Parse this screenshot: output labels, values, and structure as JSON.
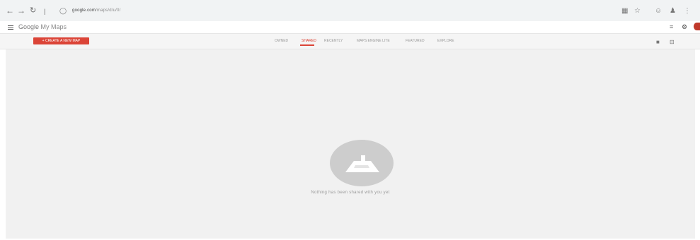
{
  "browser": {
    "url_host": "google.com",
    "url_path": "/maps/d/u/0/",
    "icons": [
      "back-icon",
      "forward-icon",
      "reload-icon",
      "site-info-icon",
      "extensions-icon",
      "star-icon",
      "profile-icon",
      "menu-icon"
    ]
  },
  "app": {
    "title_brand": "Google",
    "title_product": "My Maps"
  },
  "toolbar": {
    "create_button": "+ CREATE A NEW MAP",
    "tabs": [
      {
        "label": "OWNED"
      },
      {
        "label": "SHARED"
      },
      {
        "label": "RECENTLY"
      },
      {
        "label": "MAPS ENGINE LITE"
      },
      {
        "label": "FEATURED"
      },
      {
        "label": "EXPLORE"
      }
    ],
    "active_tab": "SHARED"
  },
  "main": {
    "empty_state_text": "Nothing has been shared with you yet"
  },
  "colors": {
    "accent": "#db4437",
    "background": "#f1f1f1"
  }
}
